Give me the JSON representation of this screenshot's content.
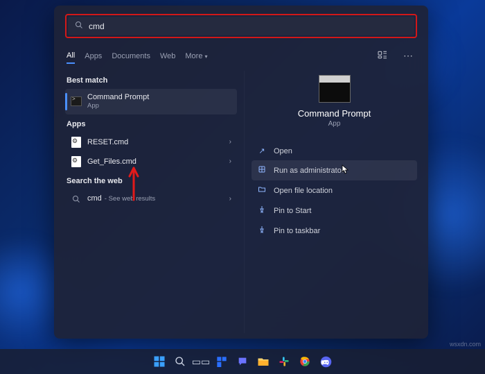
{
  "search": {
    "value": "cmd",
    "placeholder": ""
  },
  "tabs": {
    "all": "All",
    "apps": "Apps",
    "documents": "Documents",
    "web": "Web",
    "more": "More"
  },
  "sections": {
    "best_match": "Best match",
    "apps": "Apps",
    "search_web": "Search the web"
  },
  "best": {
    "title": "Command Prompt",
    "subtitle": "App"
  },
  "apps_list": [
    {
      "label": "RESET.cmd"
    },
    {
      "label": "Get_Files.cmd"
    }
  ],
  "web_result": {
    "query": "cmd",
    "hint": "See web results"
  },
  "preview": {
    "title": "Command Prompt",
    "subtitle": "App",
    "actions": {
      "open": "Open",
      "run_admin": "Run as administrator",
      "open_loc": "Open file location",
      "pin_start": "Pin to Start",
      "pin_taskbar": "Pin to taskbar"
    }
  },
  "watermark": "wsxdn.com"
}
